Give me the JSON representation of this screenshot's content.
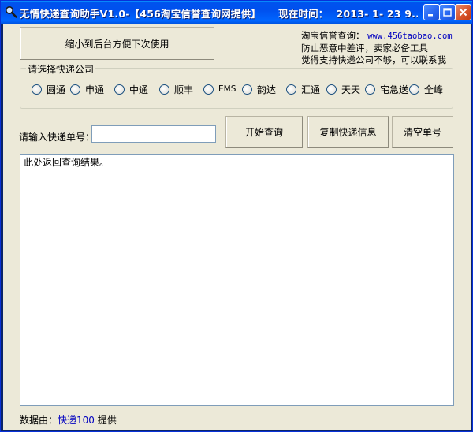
{
  "window": {
    "title": "无情快递查询助手V1.0-【456淘宝信誉查询网提供】",
    "time_label": "现在时间：",
    "time_value": "2013- 1- 23  9..."
  },
  "buttons": {
    "minimize_to_tray": "缩小到后台方便下次使用",
    "start_query": "开始查询",
    "copy_info": "复制快递信息",
    "clear_number": "清空单号"
  },
  "info": {
    "line1_label": "淘宝信誉查询：",
    "line1_url": "www.456taobao.com",
    "line2": "防止恶意中差评，卖家必备工具",
    "line3": "觉得支持快递公司不够，可以联系我"
  },
  "company_group": {
    "legend": "请选择快递公司",
    "options": [
      "圆通",
      "申通",
      "中通",
      "顺丰",
      "EMS",
      "韵达",
      "汇通",
      "天天",
      "宅急送",
      "全峰"
    ]
  },
  "tracking": {
    "label": "请输入快递单号：",
    "value": ""
  },
  "result": {
    "text": "此处返回查询结果。"
  },
  "footer": {
    "prefix": "数据由：",
    "source": "快递100",
    "suffix": " 提供"
  }
}
